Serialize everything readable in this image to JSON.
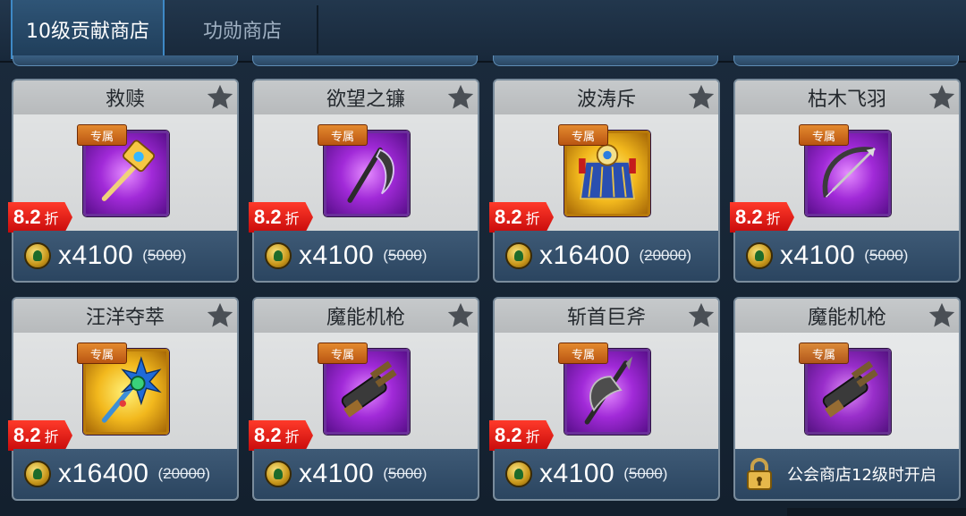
{
  "tabs": [
    {
      "label": "10级贡献商店",
      "active": true
    },
    {
      "label": "功勋商店",
      "active": false
    }
  ],
  "badge_label": "专属",
  "discount": {
    "value": "8.2",
    "unit": "折"
  },
  "items": [
    {
      "name": "救赎",
      "price": "x4100",
      "original": "5000",
      "icon": "golden-hammer-icon",
      "frame": "purple"
    },
    {
      "name": "欲望之镰",
      "price": "x4100",
      "original": "5000",
      "icon": "scythe-icon",
      "frame": "purple"
    },
    {
      "name": "波涛斥",
      "price": "x16400",
      "original": "20000",
      "icon": "ornate-shield-icon",
      "frame": "gold"
    },
    {
      "name": "枯木飞羽",
      "price": "x4100",
      "original": "5000",
      "icon": "bow-icon",
      "frame": "purple"
    },
    {
      "name": "汪洋夺萃",
      "price": "x16400",
      "original": "20000",
      "icon": "ice-staff-icon",
      "frame": "gold"
    },
    {
      "name": "魔能机枪",
      "price": "x4100",
      "original": "5000",
      "icon": "gatling-gun-icon",
      "frame": "purple"
    },
    {
      "name": "斩首巨斧",
      "price": "x4100",
      "original": "5000",
      "icon": "battle-axe-icon",
      "frame": "purple"
    },
    {
      "name": "魔能机枪",
      "locked": true,
      "lock_text": "公会商店12级时开启",
      "icon": "gatling-gun-icon",
      "frame": "purple"
    }
  ],
  "colors": {
    "discount_red": "#e0161a",
    "badge_orange": "#d2701f",
    "price_bar": "#34506c",
    "tab_active": "#2f5577"
  }
}
